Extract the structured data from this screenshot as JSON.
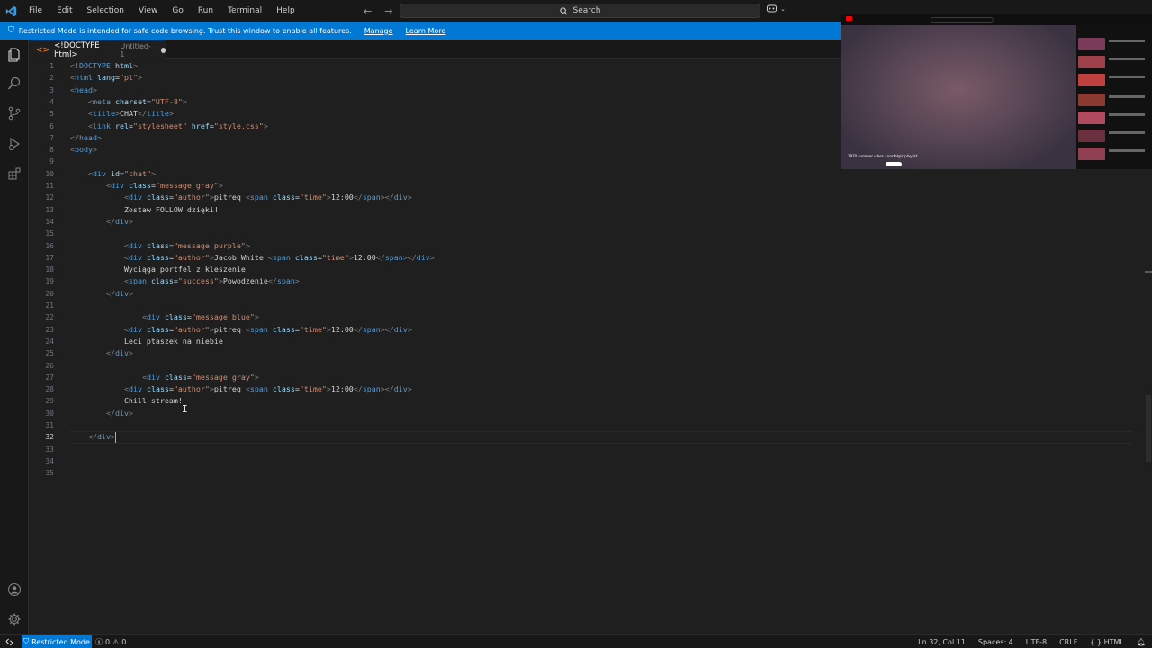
{
  "menu": [
    "File",
    "Edit",
    "Selection",
    "View",
    "Go",
    "Run",
    "Terminal",
    "Help"
  ],
  "search": {
    "label": "Search"
  },
  "banner": {
    "message": "Restricted Mode is intended for safe code browsing. Trust this window to enable all features.",
    "manage": "Manage",
    "learn_more": "Learn More"
  },
  "tab": {
    "title": "<!DOCTYPE html>",
    "subtitle": "Untitled-1"
  },
  "editor": {
    "line_numbers": [
      "1",
      "2",
      "3",
      "4",
      "5",
      "6",
      "7",
      "8",
      "9",
      "10",
      "11",
      "12",
      "13",
      "14",
      "15",
      "16",
      "17",
      "18",
      "19",
      "20",
      "21",
      "22",
      "23",
      "24",
      "25",
      "26",
      "27",
      "28",
      "29",
      "30",
      "31",
      "32",
      "33",
      "34",
      "35"
    ],
    "active_line": 32,
    "lines": [
      "<!DOCTYPE html>",
      "<html lang=\"pl\">",
      "<head>",
      "    <meta charset=\"UTF-8\">",
      "    <title>CHAT</title>",
      "    <link rel=\"stylesheet\" href=\"style.css\">",
      "</head>",
      "<body>",
      "",
      "    <div id=\"chat\">",
      "        <div class=\"message gray\">",
      "            <div class=\"author\">pitreq <span class=\"time\">12:00</span></div>",
      "            Zostaw FOLLOW dzięki!",
      "        </div>",
      "",
      "            <div class=\"message purple\">",
      "            <div class=\"author\">Jacob White <span class=\"time\">12:00</span></div>",
      "            Wyciąga portfel z kleszenie",
      "            <span class=\"success\">Powodzenie</span>",
      "        </div>",
      "",
      "                <div class=\"message blue\">",
      "            <div class=\"author\">pitreq <span class=\"time\">12:00</span></div>",
      "            Leci ptaszek na niebie",
      "        </div>",
      "",
      "                <div class=\"message gray\">",
      "            <div class=\"author\">pitreq <span class=\"time\">12:00</span></div>",
      "            Chill stream!",
      "        </div>",
      "",
      "    </div>",
      "",
      "",
      ""
    ]
  },
  "video": {
    "title": "1970 summer vibes - nostalgic playlist"
  },
  "statusbar": {
    "restricted": "Restricted Mode",
    "errors": "0",
    "warnings": "0",
    "position": "Ln 32, Col 11",
    "spaces": "Spaces: 4",
    "encoding": "UTF-8",
    "eol": "CRLF",
    "language": "HTML"
  },
  "colors": {
    "accent": "#0078d4",
    "editor_bg": "#1f1f1f",
    "tag": "#569cd6",
    "attr": "#9cdcfe",
    "string": "#ce9178"
  }
}
